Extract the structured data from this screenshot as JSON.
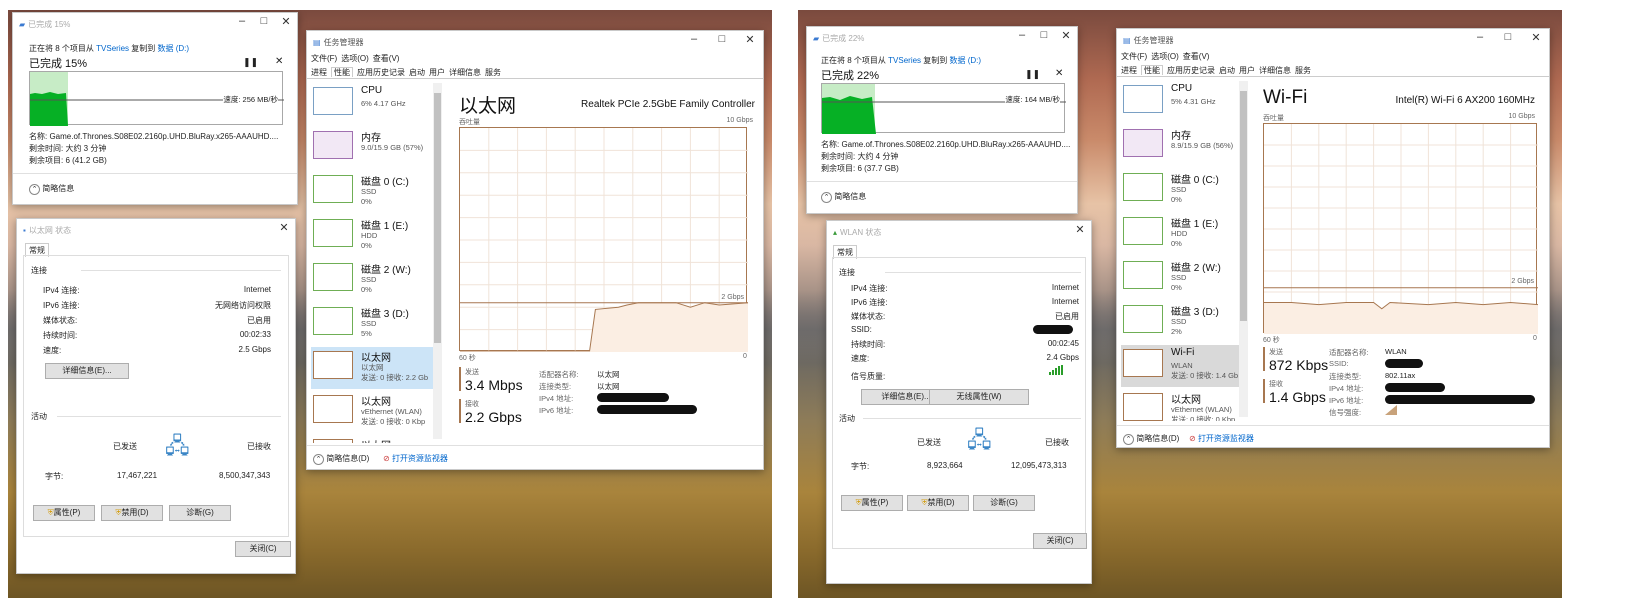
{
  "left": {
    "copy": {
      "title": "已完成 15%",
      "from_text": "正在将 8 个项目从",
      "src": "TVSeries",
      "mid": "复制到",
      "dst": "数据 (D:)",
      "done": "已完成 15%",
      "speed": "速度: 256 MB/秒",
      "progress": 0.15,
      "name_line": "名称: Game.of.Thrones.S08E02.2160p.UHD.BluRay.x265-AAAUHD....",
      "remaining_time": "剩余时间: 大约 3 分钟",
      "remaining_items": "剩余项目: 6 (41.2 GB)",
      "less_info": "简略信息"
    },
    "status": {
      "title": "以太网 状态",
      "tab": "常规",
      "section_conn": "连接",
      "rows": [
        {
          "k": "IPv4 连接:",
          "v": "Internet"
        },
        {
          "k": "IPv6 连接:",
          "v": "无网络访问权限"
        },
        {
          "k": "媒体状态:",
          "v": "已启用"
        },
        {
          "k": "持续时间:",
          "v": "00:02:33"
        },
        {
          "k": "速度:",
          "v": "2.5 Gbps"
        }
      ],
      "details_btn": "详细信息(E)...",
      "section_activity": "活动",
      "sent": "已发送",
      "received": "已接收",
      "bytes_label": "字节:",
      "bytes_sent": "17,467,221",
      "bytes_received": "8,500,347,343",
      "btn_props": "属性(P)",
      "btn_disable": "禁用(D)",
      "btn_diag": "诊断(G)",
      "btn_close": "关闭(C)"
    },
    "tm": {
      "title": "任务管理器",
      "menu": [
        "文件(F)",
        "选项(O)",
        "查看(V)"
      ],
      "tabs": [
        "进程",
        "性能",
        "应用历史记录",
        "启动",
        "用户",
        "详细信息",
        "服务"
      ],
      "side": [
        {
          "t1": "CPU",
          "t2": "6% 4.17 GHz",
          "t3": ""
        },
        {
          "t1": "内存",
          "t2": "9.0/15.9 GB (57%)",
          "t3": ""
        },
        {
          "t1": "磁盘 0 (C:)",
          "t2": "SSD",
          "t3": "0%"
        },
        {
          "t1": "磁盘 1 (E:)",
          "t2": "HDD",
          "t3": "0%"
        },
        {
          "t1": "磁盘 2 (W:)",
          "t2": "SSD",
          "t3": "0%"
        },
        {
          "t1": "磁盘 3 (D:)",
          "t2": "SSD",
          "t3": "5%"
        },
        {
          "t1": "以太网",
          "t2": "以太网",
          "t3": "发送: 0 接收: 2.2 Gb"
        },
        {
          "t1": "以太网",
          "t2": "vEthernet (WLAN)",
          "t3": "发送: 0 接收: 0 Kbp"
        },
        {
          "t1": "以太网",
          "t2": "",
          "t3": ""
        }
      ],
      "heading": "以太网",
      "adapter": "Realtek PCIe 2.5GbE Family Controller",
      "throughput": "吞吐量",
      "max": "10 Gbps",
      "mark": "2 Gbps",
      "x_left": "60 秒",
      "x_right": "0",
      "send_label": "发送",
      "send_val": "3.4 Mbps",
      "recv_label": "接收",
      "recv_val": "2.2 Gbps",
      "info": [
        {
          "k": "适配器名称:",
          "v": "以太网"
        },
        {
          "k": "连接类型:",
          "v": "以太网"
        },
        {
          "k": "IPv4 地址:",
          "v": ""
        },
        {
          "k": "IPv6 地址:",
          "v": ""
        }
      ],
      "less_info": "简略信息(D)",
      "open_monitor": "打开资源监视器"
    }
  },
  "right": {
    "copy": {
      "title": "已完成 22%",
      "from_text": "正在将 8 个项目从",
      "src": "TVSeries",
      "mid": "复制到",
      "dst": "数据 (D:)",
      "done": "已完成 22%",
      "speed": "速度: 164 MB/秒",
      "progress": 0.22,
      "name_line": "名称: Game.of.Thrones.S08E02.2160p.UHD.BluRay.x265-AAAUHD....",
      "remaining_time": "剩余时间: 大约 4 分钟",
      "remaining_items": "剩余项目: 6 (37.7 GB)",
      "less_info": "简略信息"
    },
    "status": {
      "title": "WLAN 状态",
      "tab": "常规",
      "section_conn": "连接",
      "rows": [
        {
          "k": "IPv4 连接:",
          "v": "Internet"
        },
        {
          "k": "IPv6 连接:",
          "v": "Internet"
        },
        {
          "k": "媒体状态:",
          "v": "已启用"
        },
        {
          "k": "SSID:",
          "v": ""
        },
        {
          "k": "持续时间:",
          "v": "00:02:45"
        },
        {
          "k": "速度:",
          "v": "2.4 Gbps"
        }
      ],
      "signal_label": "信号质量:",
      "details_btn": "详细信息(E)...",
      "wireless_btn": "无线属性(W)",
      "section_activity": "活动",
      "sent": "已发送",
      "received": "已接收",
      "bytes_label": "字节:",
      "bytes_sent": "8,923,664",
      "bytes_received": "12,095,473,313",
      "btn_props": "属性(P)",
      "btn_disable": "禁用(D)",
      "btn_diag": "诊断(G)",
      "btn_close": "关闭(C)"
    },
    "tm": {
      "title": "任务管理器",
      "menu": [
        "文件(F)",
        "选项(O)",
        "查看(V)"
      ],
      "tabs": [
        "进程",
        "性能",
        "应用历史记录",
        "启动",
        "用户",
        "详细信息",
        "服务"
      ],
      "side": [
        {
          "t1": "CPU",
          "t2": "5% 4.31 GHz",
          "t3": ""
        },
        {
          "t1": "内存",
          "t2": "8.9/15.9 GB (56%)",
          "t3": ""
        },
        {
          "t1": "磁盘 0 (C:)",
          "t2": "SSD",
          "t3": "0%"
        },
        {
          "t1": "磁盘 1 (E:)",
          "t2": "HDD",
          "t3": "0%"
        },
        {
          "t1": "磁盘 2 (W:)",
          "t2": "SSD",
          "t3": "0%"
        },
        {
          "t1": "磁盘 3 (D:)",
          "t2": "SSD",
          "t3": "2%"
        },
        {
          "t1": "Wi-Fi",
          "t2": "WLAN",
          "t3": "发送: 0 接收: 1.4 Gb"
        },
        {
          "t1": "以太网",
          "t2": "vEthernet (WLAN)",
          "t3": "发送: 0 接收: 0 Kbp"
        },
        {
          "t1": "以太网",
          "t2": "",
          "t3": ""
        }
      ],
      "heading": "Wi-Fi",
      "adapter": "Intel(R) Wi-Fi 6 AX200 160MHz",
      "throughput": "吞吐量",
      "max": "10 Gbps",
      "mark": "2 Gbps",
      "x_left": "60 秒",
      "x_right": "0",
      "send_label": "发送",
      "send_val": "872 Kbps",
      "recv_label": "接收",
      "recv_val": "1.4 Gbps",
      "info": [
        {
          "k": "适配器名称:",
          "v": "WLAN"
        },
        {
          "k": "SSID:",
          "v": ""
        },
        {
          "k": "连接类型:",
          "v": "802.11ax"
        },
        {
          "k": "IPv4 地址:",
          "v": ""
        },
        {
          "k": "IPv6 地址:",
          "v": ""
        },
        {
          "k": "信号强度:",
          "v": ""
        }
      ],
      "less_info": "简略信息(D)",
      "open_monitor": "打开资源监视器"
    }
  },
  "colors": {
    "link": "#0066cc",
    "progress_green": "#06b025",
    "graph_line": "#a77750",
    "graph_fill": "#fbeee3",
    "select_blue": "#cce4f7"
  }
}
